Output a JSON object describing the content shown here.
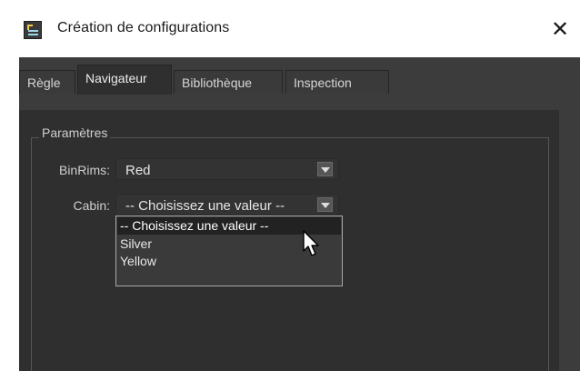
{
  "window": {
    "title": "Création de configurations",
    "close_glyph": "✕",
    "app_icon": "app-window-icon"
  },
  "tabs": [
    {
      "label": "Règle",
      "active": false
    },
    {
      "label": "Navigateur",
      "active": true
    },
    {
      "label": "Bibliothèque",
      "active": false
    },
    {
      "label": "Inspection",
      "active": false
    }
  ],
  "colors": {
    "accent": "#7cb342",
    "panel": "#2f2f2f",
    "background": "#3c3c3c"
  },
  "group": {
    "title": "Paramètres"
  },
  "fields": {
    "binrims": {
      "label": "BinRims:",
      "value": "Red"
    },
    "cabin": {
      "label": "Cabin:",
      "value": "-- Choisissez une valeur --"
    }
  },
  "dropdown": {
    "options": [
      {
        "label": "-- Choisissez une valeur --",
        "selected": true
      },
      {
        "label": "Silver",
        "selected": false
      },
      {
        "label": "Yellow",
        "selected": false
      }
    ]
  },
  "cursor_icon": "mouse-pointer-icon"
}
